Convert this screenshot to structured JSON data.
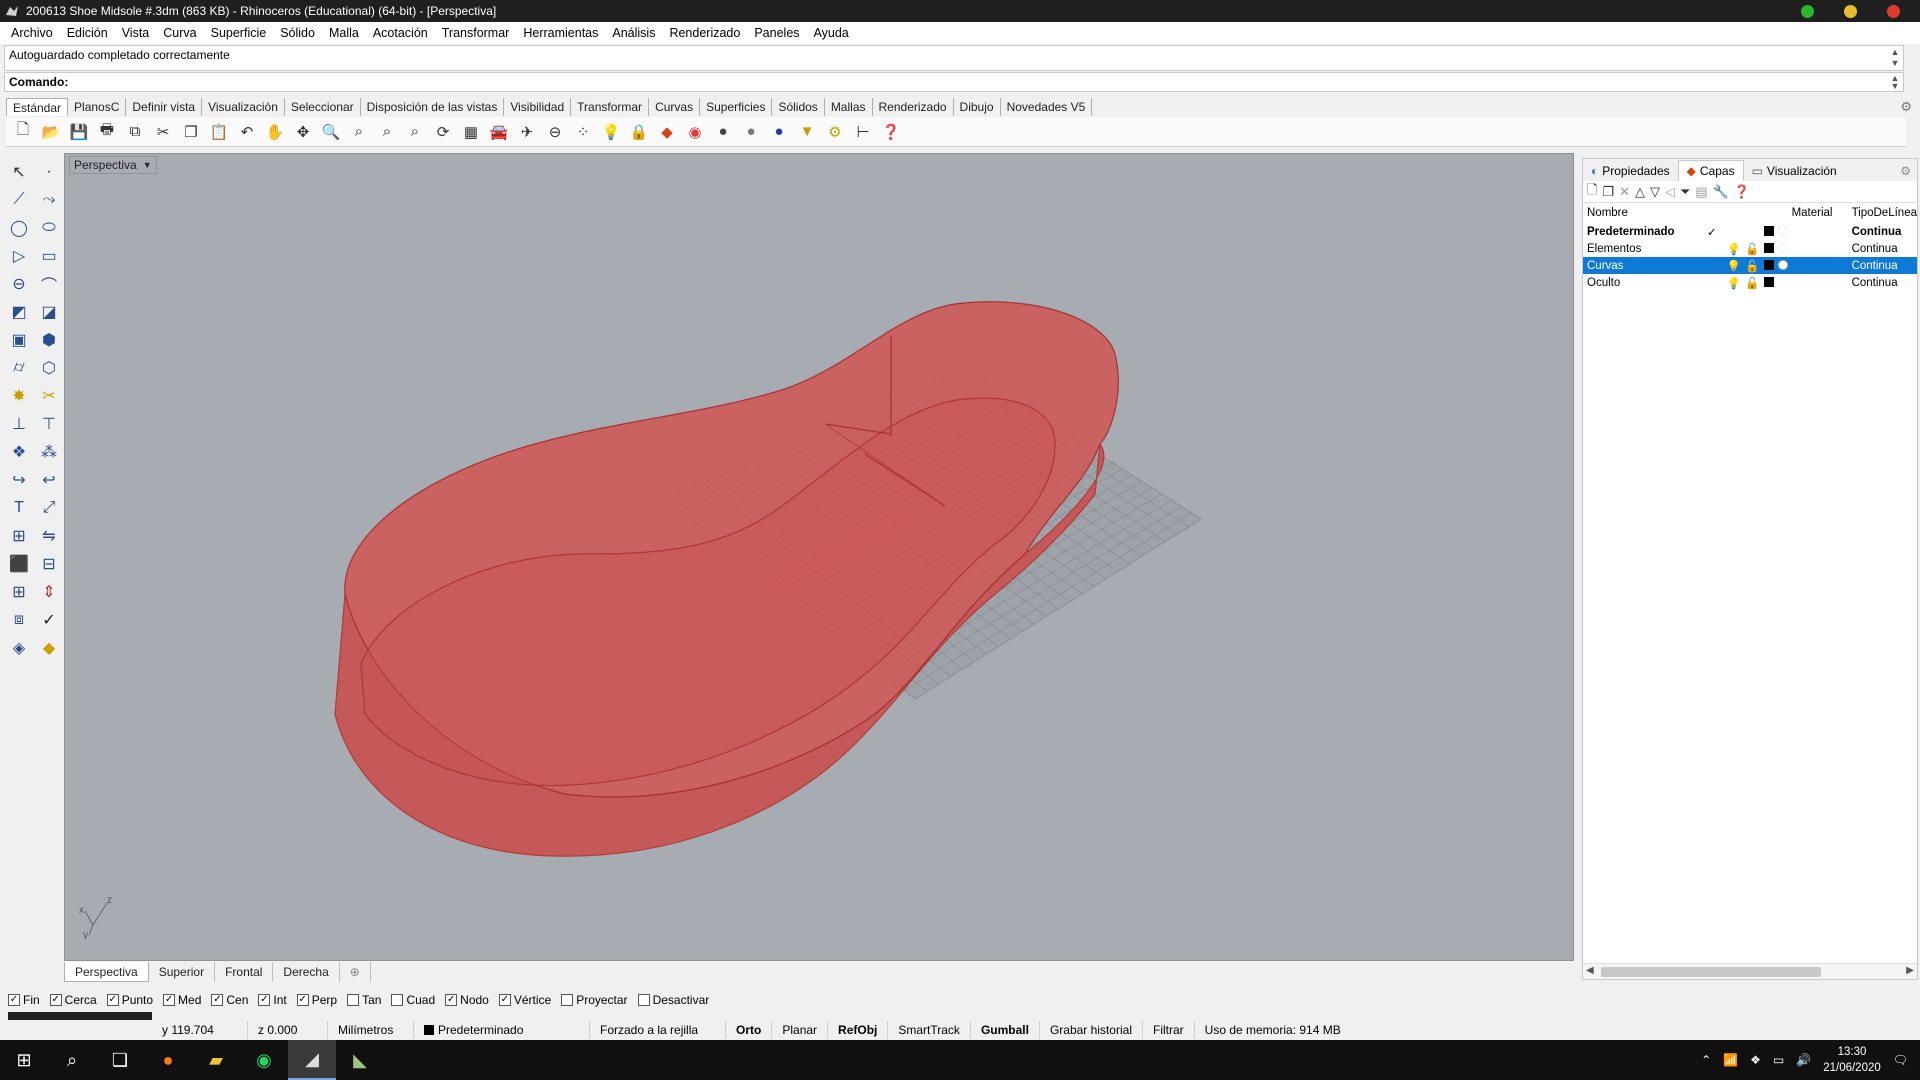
{
  "titlebar": {
    "title": "200613 Shoe Midsole #.3dm (863 KB) - Rhinoceros (Educational) (64-bit) - [Perspectiva]",
    "btn_colors": [
      "#2db52d",
      "#e5c02a",
      "#e03a2f"
    ]
  },
  "menu": [
    "Archivo",
    "Edición",
    "Vista",
    "Curva",
    "Superficie",
    "Sólido",
    "Malla",
    "Acotación",
    "Transformar",
    "Herramientas",
    "Análisis",
    "Renderizado",
    "Paneles",
    "Ayuda"
  ],
  "command": {
    "history": "Autoguardado completado correctamente",
    "label": "Comando:",
    "value": ""
  },
  "toolbar_tabs": [
    "Estándar",
    "PlanosC",
    "Definir vista",
    "Visualización",
    "Seleccionar",
    "Disposición de las vistas",
    "Visibilidad",
    "Transformar",
    "Curvas",
    "Superficies",
    "Sólidos",
    "Mallas",
    "Renderizado",
    "Dibujo",
    "Novedades V5"
  ],
  "viewport": {
    "label": "Perspectiva",
    "axis_x": "x",
    "axis_y": "y",
    "axis_z": "z",
    "shape_color": "#c9504f",
    "background": "#a7abb2"
  },
  "viewport_tabs": [
    "Perspectiva",
    "Superior",
    "Frontal",
    "Derecha"
  ],
  "right_panel": {
    "tabs": [
      "Propiedades",
      "Capas",
      "Visualización"
    ],
    "columns": {
      "name": "Nombre",
      "material": "Material",
      "linetype": "TipoDeLínea"
    },
    "layers": [
      {
        "name": "Predeterminado",
        "check": "✓",
        "linetype": "Continua",
        "bold": true,
        "selected": false
      },
      {
        "name": "Elementos",
        "check": "",
        "linetype": "Continua",
        "bold": false,
        "selected": false
      },
      {
        "name": "Curvas",
        "check": "",
        "linetype": "Continua",
        "bold": false,
        "selected": true
      },
      {
        "name": "Oculto",
        "check": "",
        "linetype": "Continua",
        "bold": false,
        "selected": false
      }
    ],
    "selection_color": "#0f7ad6"
  },
  "osnaps": [
    {
      "label": "Fin",
      "checked": true
    },
    {
      "label": "Cerca",
      "checked": true
    },
    {
      "label": "Punto",
      "checked": true
    },
    {
      "label": "Med",
      "checked": true
    },
    {
      "label": "Cen",
      "checked": true
    },
    {
      "label": "Int",
      "checked": true
    },
    {
      "label": "Perp",
      "checked": true
    },
    {
      "label": "Tan",
      "checked": false
    },
    {
      "label": "Cuad",
      "checked": false
    },
    {
      "label": "Nodo",
      "checked": true
    },
    {
      "label": "Vértice",
      "checked": true
    },
    {
      "label": "Proyectar",
      "checked": false
    },
    {
      "label": "Desactivar",
      "checked": false
    }
  ],
  "status": {
    "y": "y 119.704",
    "z": "z 0.000",
    "units": "Milímetros",
    "layer": "Predeterminado",
    "snap": "Forzado a la rejilla",
    "ortho": "Orto",
    "planar": "Planar",
    "refobj": "RefObj",
    "smarttrack": "SmartTrack",
    "gumball": "Gumball",
    "history": "Grabar historial",
    "filter": "Filtrar",
    "memory": "Uso de memoria: 914 MB"
  },
  "taskbar": {
    "time": "13:30",
    "date": "21/06/2020"
  }
}
